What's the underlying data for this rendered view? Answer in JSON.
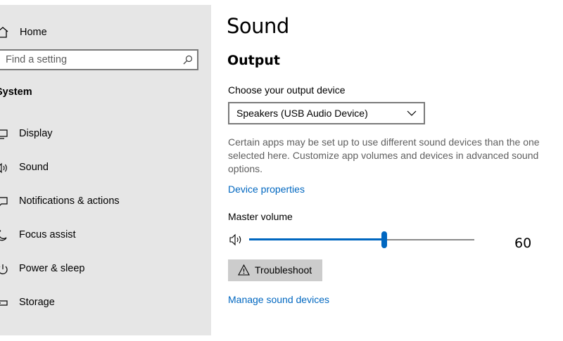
{
  "sidebar": {
    "home": {
      "label": "Home",
      "icon": "home-icon"
    },
    "search": {
      "placeholder": "Find a setting",
      "icon": "search-icon"
    },
    "section_title": "System",
    "items": [
      {
        "label": "Display",
        "icon": "display-icon"
      },
      {
        "label": "Sound",
        "icon": "speaker-icon"
      },
      {
        "label": "Notifications & actions",
        "icon": "notification-icon"
      },
      {
        "label": "Focus assist",
        "icon": "moon-icon"
      },
      {
        "label": "Power & sleep",
        "icon": "power-icon"
      },
      {
        "label": "Storage",
        "icon": "storage-icon"
      }
    ]
  },
  "main": {
    "title": "Sound",
    "output": {
      "heading": "Output",
      "device_label": "Choose your output device",
      "device_value": "Speakers (USB Audio Device)",
      "description": "Certain apps may be set up to use different sound devices than the one selected here. Customize app volumes and devices in advanced sound options.",
      "device_properties_link": "Device properties",
      "master_volume_label": "Master volume",
      "volume": 60,
      "volume_display": "60",
      "troubleshoot_label": "Troubleshoot",
      "manage_link": "Manage sound devices"
    }
  },
  "colors": {
    "sidebar_bg": "#e6e6e6",
    "accent": "#0067c0",
    "button_bg": "#cccccc",
    "muted_text": "#5f5f5f"
  }
}
